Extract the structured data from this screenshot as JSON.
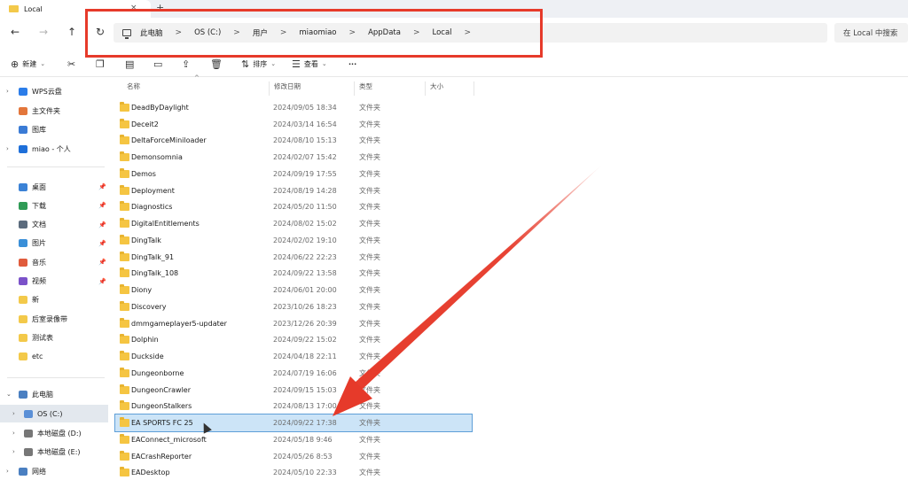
{
  "tab": {
    "title": "Local",
    "close": "×",
    "add": "+"
  },
  "nav": {
    "back": "←",
    "forward": "→",
    "up": "↑",
    "refresh": "↻"
  },
  "address": {
    "crumbs": [
      "此电脑",
      "OS (C:)",
      "用户",
      "miaomiao",
      "AppData",
      "Local"
    ],
    "separator": ">"
  },
  "search": {
    "placeholder": "在 Local 中搜索"
  },
  "toolbar": {
    "new_label": "新建",
    "sort_label": "排序",
    "view_label": "查看",
    "more_label": "···"
  },
  "sidebar": {
    "top": [
      {
        "label": "WPS云盘",
        "color": "#2b7de9"
      },
      {
        "label": "主文件夹",
        "color": "#e3763b"
      },
      {
        "label": "图库",
        "color": "#3a7bd5"
      },
      {
        "label": "miao - 个人",
        "color": "#1e6fd9"
      }
    ],
    "quick": [
      {
        "label": "桌面",
        "color": "#3b82d6",
        "pinned": true
      },
      {
        "label": "下载",
        "color": "#2f9b55",
        "pinned": true
      },
      {
        "label": "文档",
        "color": "#5b6b7d",
        "pinned": true
      },
      {
        "label": "图片",
        "color": "#3a8fd8",
        "pinned": true
      },
      {
        "label": "音乐",
        "color": "#e05b3c",
        "pinned": true
      },
      {
        "label": "视频",
        "color": "#7b52c9",
        "pinned": true
      },
      {
        "label": "新",
        "color": "#f3c94a",
        "pinned": false
      },
      {
        "label": "后室录像带",
        "color": "#f3c94a",
        "pinned": false
      },
      {
        "label": "测试表",
        "color": "#f3c94a",
        "pinned": false
      },
      {
        "label": "etc",
        "color": "#f3c94a",
        "pinned": false
      }
    ],
    "pc": [
      {
        "label": "此电脑",
        "color": "#4a7fc1"
      },
      {
        "label": "OS (C:)",
        "color": "#5a8fd6"
      },
      {
        "label": "本地磁盘 (D:)",
        "color": "#777777"
      },
      {
        "label": "本地磁盘 (E:)",
        "color": "#777777"
      },
      {
        "label": "网络",
        "color": "#4a7fc1"
      }
    ]
  },
  "columns": {
    "name": "名称",
    "date": "修改日期",
    "type": "类型",
    "size": "大小"
  },
  "files": [
    {
      "name": "DeadByDaylight",
      "date": "2024/09/05 18:34",
      "type": "文件夹"
    },
    {
      "name": "Deceit2",
      "date": "2024/03/14 16:54",
      "type": "文件夹"
    },
    {
      "name": "DeltaForceMiniloader",
      "date": "2024/08/10 15:13",
      "type": "文件夹"
    },
    {
      "name": "Demonsomnia",
      "date": "2024/02/07 15:42",
      "type": "文件夹"
    },
    {
      "name": "Demos",
      "date": "2024/09/19 17:55",
      "type": "文件夹"
    },
    {
      "name": "Deployment",
      "date": "2024/08/19 14:28",
      "type": "文件夹"
    },
    {
      "name": "Diagnostics",
      "date": "2024/05/20 11:50",
      "type": "文件夹"
    },
    {
      "name": "DigitalEntitlements",
      "date": "2024/08/02 15:02",
      "type": "文件夹"
    },
    {
      "name": "DingTalk",
      "date": "2024/02/02 19:10",
      "type": "文件夹"
    },
    {
      "name": "DingTalk_91",
      "date": "2024/06/22 22:23",
      "type": "文件夹"
    },
    {
      "name": "DingTalk_108",
      "date": "2024/09/22 13:58",
      "type": "文件夹"
    },
    {
      "name": "Diony",
      "date": "2024/06/01 20:00",
      "type": "文件夹"
    },
    {
      "name": "Discovery",
      "date": "2023/10/26 18:23",
      "type": "文件夹"
    },
    {
      "name": "dmmgameplayer5-updater",
      "date": "2023/12/26 20:39",
      "type": "文件夹"
    },
    {
      "name": "Dolphin",
      "date": "2024/09/22 15:02",
      "type": "文件夹"
    },
    {
      "name": "Duckside",
      "date": "2024/04/18 22:11",
      "type": "文件夹"
    },
    {
      "name": "Dungeonborne",
      "date": "2024/07/19 16:06",
      "type": "文件夹"
    },
    {
      "name": "DungeonCrawler",
      "date": "2024/09/15 15:03",
      "type": "文件夹"
    },
    {
      "name": "DungeonStalkers",
      "date": "2024/08/13 17:00",
      "type": "文件夹"
    },
    {
      "name": "EA SPORTS FC 25",
      "date": "2024/09/22 17:38",
      "type": "文件夹",
      "selected": true
    },
    {
      "name": "EAConnect_microsoft",
      "date": "2024/05/18 9:46",
      "type": "文件夹"
    },
    {
      "name": "EACrashReporter",
      "date": "2024/05/26 8:53",
      "type": "文件夹"
    },
    {
      "name": "EADesktop",
      "date": "2024/05/10 22:33",
      "type": "文件夹"
    }
  ],
  "colors": {
    "annotation_red": "#e63a2a",
    "selection_bg": "#cce4f7",
    "selection_border": "#5e9fd8",
    "folder": "#f5c542"
  }
}
